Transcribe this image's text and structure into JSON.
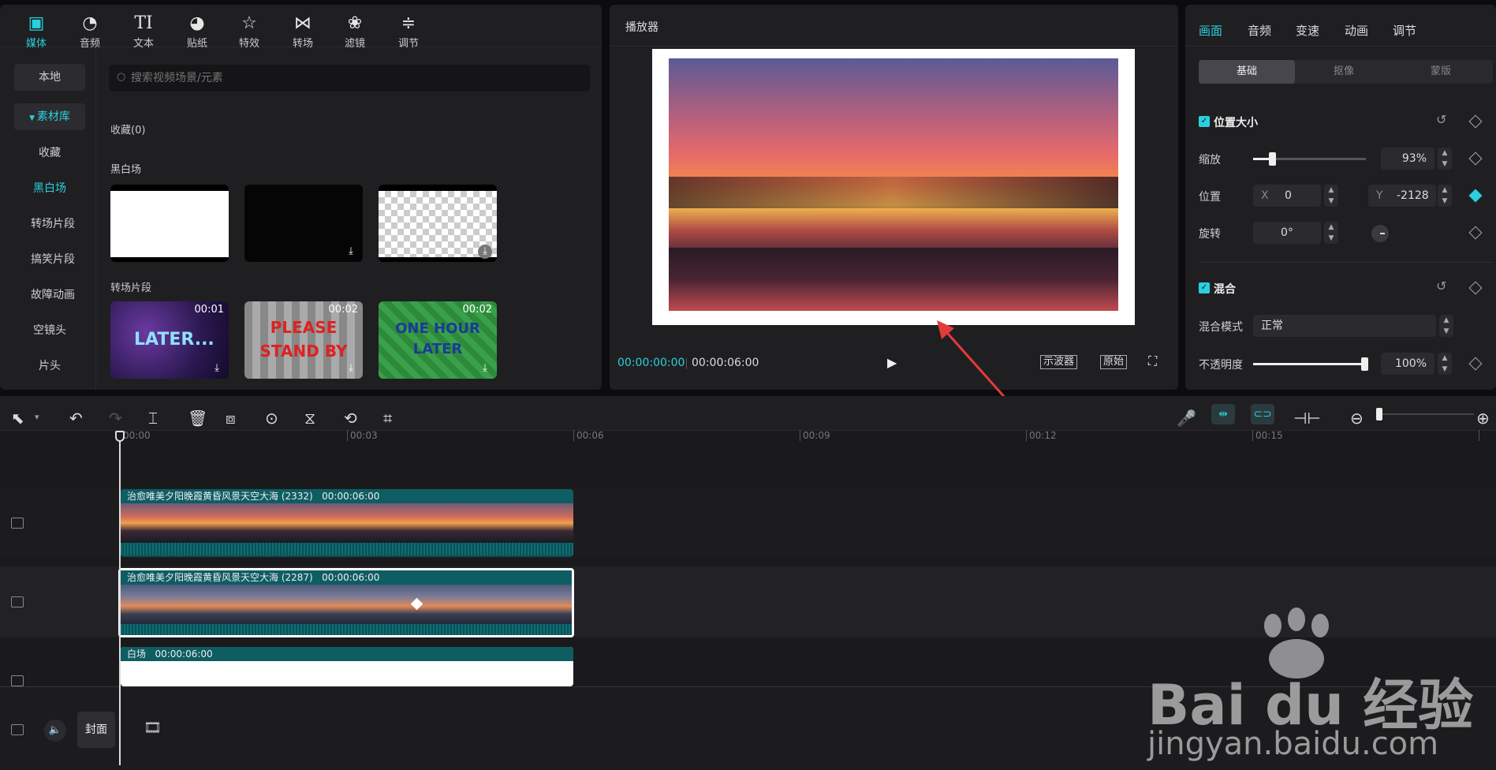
{
  "toolbar": {
    "items": [
      {
        "label": "媒体",
        "icon": "play-square-icon"
      },
      {
        "label": "音频",
        "icon": "music-icon"
      },
      {
        "label": "文本",
        "icon": "text-icon"
      },
      {
        "label": "贴纸",
        "icon": "sticker-icon"
      },
      {
        "label": "特效",
        "icon": "star-icon"
      },
      {
        "label": "转场",
        "icon": "transition-icon"
      },
      {
        "label": "滤镜",
        "icon": "filter-icon"
      },
      {
        "label": "调节",
        "icon": "sliders-icon"
      }
    ]
  },
  "sidebar": {
    "local": "本地",
    "library": "素材库",
    "items": [
      "收藏",
      "黑白场",
      "转场片段",
      "搞笑片段",
      "故障动画",
      "空镜头",
      "片头"
    ]
  },
  "media": {
    "search_placeholder": "搜索视频场景/元素",
    "favorites": "收藏(0)",
    "section1": "黑白场",
    "section2": "转场片段",
    "clips": [
      {
        "duration": "00:01",
        "text": "LATER..."
      },
      {
        "duration": "00:02",
        "text": "PLEASE STAND BY"
      },
      {
        "duration": "00:02",
        "text": "ONE HOUR LATER"
      }
    ]
  },
  "player": {
    "title": "播放器",
    "current_time": "00:00:00:00",
    "total_time": "00:00:06:00",
    "oscilloscope": "示波器",
    "original": "原始"
  },
  "properties": {
    "tabs": [
      "画面",
      "音频",
      "变速",
      "动画",
      "调节"
    ],
    "subtabs": [
      "基础",
      "抠像",
      "蒙版"
    ],
    "pos_size": "位置大小",
    "scale_label": "缩放",
    "scale_value": "93%",
    "scale_level": 0.1,
    "position_label": "位置",
    "x_label": "X",
    "x_value": "0",
    "y_label": "Y",
    "y_value": "-2128",
    "rotate_label": "旋转",
    "rotate_value": "0°",
    "blend": "混合",
    "blend_mode_label": "混合模式",
    "blend_mode_value": "正常",
    "opacity_label": "不透明度",
    "opacity_value": "100%",
    "opacity_level": 1.0
  },
  "timeline": {
    "ruler": [
      "00:00",
      "00:03",
      "00:06",
      "00:09",
      "00:12",
      "00:15"
    ],
    "track1_name": "治愈唯美夕阳晚霞黄昏风景天空大海 (2332)",
    "track1_dur": "00:00:06:00",
    "track2_name": "治愈唯美夕阳晚霞黄昏风景天空大海 (2287)",
    "track2_dur": "00:00:06:00",
    "track3_name": "白场",
    "track3_dur": "00:00:06:00",
    "cover": "封面"
  },
  "watermark": {
    "brand": "Bai du 经验",
    "url": "jingyan.baidu.com"
  }
}
